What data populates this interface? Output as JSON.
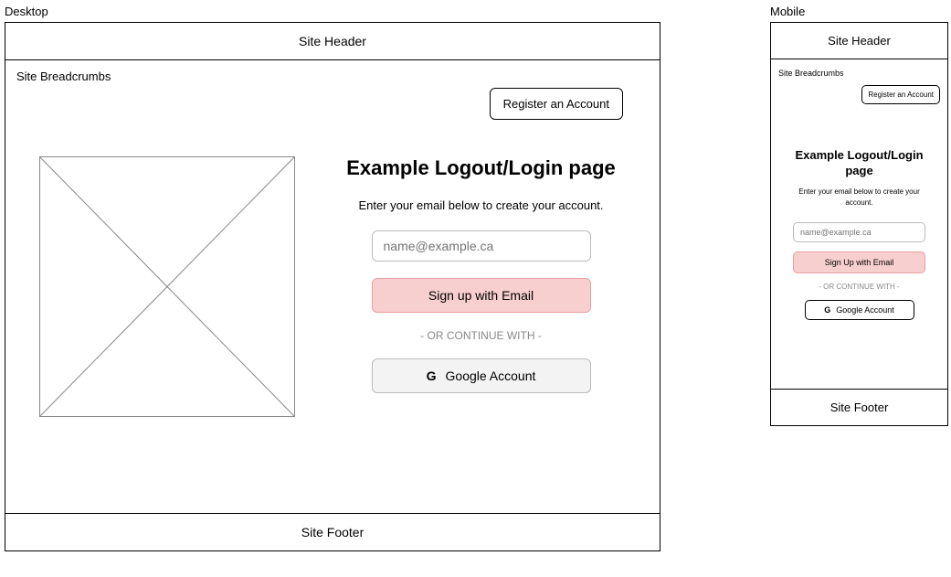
{
  "desktop": {
    "label": "Desktop",
    "header": "Site Header",
    "breadcrumbs": "Site Breadcrumbs",
    "register_label": "Register an Account",
    "title": "Example Logout/Login page",
    "subtitle": "Enter your email below to create your account.",
    "email_placeholder": "name@example.ca",
    "signup_label": "Sign up with Email",
    "divider_text": "- OR CONTINUE WITH -",
    "google_g": "G",
    "google_label": "Google Account",
    "footer": "Site Footer"
  },
  "mobile": {
    "label": "Mobile",
    "header": "Site Header",
    "breadcrumbs": "Site Breadcrumbs",
    "register_label": "Register an Account",
    "title": "Example Logout/Login page",
    "subtitle": "Enter your email below to create your account.",
    "email_placeholder": "name@example.ca",
    "signup_label": "Sign Up with Email",
    "divider_text": "- OR CONTINUE WITH -",
    "google_g": "G",
    "google_label": "Google Account",
    "footer": "Site Footer"
  }
}
